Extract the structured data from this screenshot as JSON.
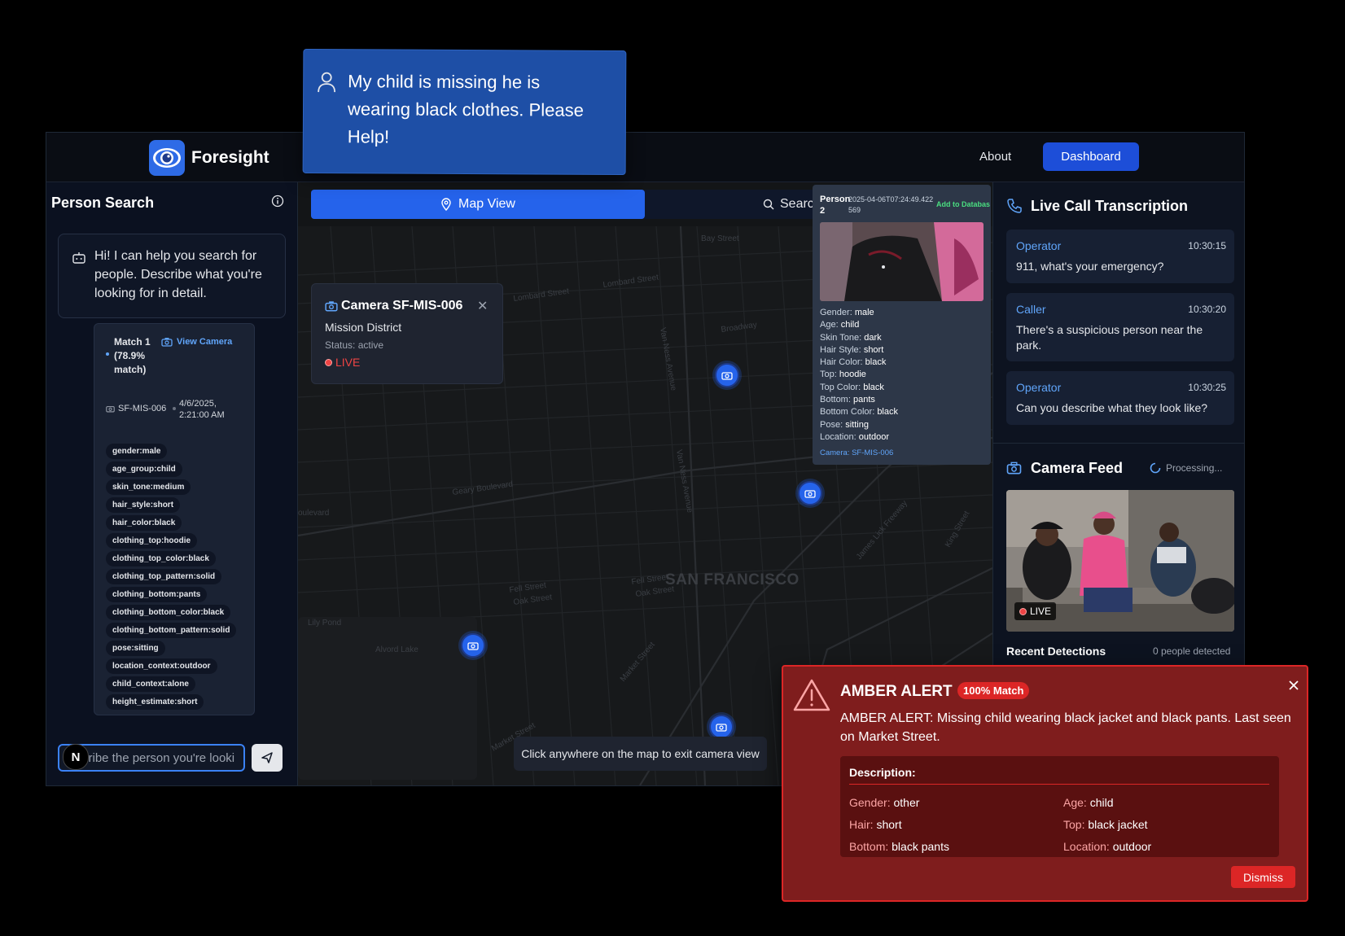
{
  "app": {
    "name": "Foresight",
    "nav": {
      "about": "About",
      "dashboard": "Dashboard"
    }
  },
  "chat_bubble": {
    "text": "My child is missing he is wearing black clothes. Please Help!",
    "icon": "user-icon"
  },
  "person_search": {
    "title": "Person Search",
    "bot_message": "Hi! I can help you search for people. Describe what you're looking for in detail.",
    "match": {
      "title": "Match 1 (78.9% match)",
      "view_camera": "View Camera",
      "camera_id": "SF-MIS-006",
      "timestamp": "4/6/2025, 2:21:00 AM",
      "tags": [
        "gender:male",
        "age_group:child",
        "skin_tone:medium",
        "hair_style:short",
        "hair_color:black",
        "clothing_top:hoodie",
        "clothing_top_color:black",
        "clothing_top_pattern:solid",
        "clothing_bottom:pants",
        "clothing_bottom_color:black",
        "clothing_bottom_pattern:solid",
        "pose:sitting",
        "location_context:outdoor",
        "child_context:alone",
        "height_estimate:short"
      ]
    },
    "input_value": "cribe the person you're looki",
    "avatar_letter": "N"
  },
  "map": {
    "tabs": {
      "map_view": "Map View",
      "search": "Search"
    },
    "city_label": "SAN FRANCISCO",
    "camera_popup": {
      "title": "Camera SF-MIS-006",
      "district": "Mission District",
      "status": "Status: active",
      "live": "LIVE"
    },
    "exit_hint": "Click anywhere on the map to exit camera view",
    "streets": [
      "Bay Street",
      "Lombard Street",
      "Lombard Street",
      "Broadway",
      "Van Ness Avenue",
      "Geary Boulevard",
      "oulevard",
      "Van Ness Avenue",
      "Fell Street",
      "Oak Street",
      "Fell Street",
      "Oak Street",
      "Lily Pond",
      "Alvord Lake",
      "Market Street",
      "Market Street",
      "James Lick Freeway",
      "King Street"
    ]
  },
  "person_popup": {
    "title": "Person 2",
    "timestamp": "2025-04-06T07:24:49.422569",
    "add_to_db": "Add to Databas",
    "attributes": [
      {
        "k": "Gender:",
        "v": "male"
      },
      {
        "k": "Age:",
        "v": "child"
      },
      {
        "k": "Skin Tone:",
        "v": "dark"
      },
      {
        "k": "Hair Style:",
        "v": "short"
      },
      {
        "k": "Hair Color:",
        "v": "black"
      },
      {
        "k": "Top:",
        "v": "hoodie"
      },
      {
        "k": "Top Color:",
        "v": "black"
      },
      {
        "k": "Bottom:",
        "v": "pants"
      },
      {
        "k": "Bottom Color:",
        "v": "black"
      },
      {
        "k": "Pose:",
        "v": "sitting"
      },
      {
        "k": "Location:",
        "v": "outdoor"
      }
    ],
    "camera": "Camera: SF-MIS-006"
  },
  "transcription": {
    "title": "Live Call Transcription",
    "messages": [
      {
        "role": "Operator",
        "time": "10:30:15",
        "text": "911, what's your emergency?"
      },
      {
        "role": "Caller",
        "time": "10:30:20",
        "text": "There's a suspicious person near the park."
      },
      {
        "role": "Operator",
        "time": "10:30:25",
        "text": "Can you describe what they look like?"
      }
    ]
  },
  "camera_feed": {
    "title": "Camera Feed",
    "processing": "Processing...",
    "live": "LIVE",
    "recent_detections": "Recent Detections",
    "people_count": "0 people detected"
  },
  "amber_alert": {
    "title": "AMBER ALERT",
    "badge": "100% Match",
    "message": "AMBER ALERT: Missing child wearing black jacket and black pants. Last seen on Market Street.",
    "description_title": "Description:",
    "fields": {
      "gender": {
        "k": "Gender:",
        "v": "other"
      },
      "age": {
        "k": "Age:",
        "v": "child"
      },
      "hair": {
        "k": "Hair:",
        "v": "short"
      },
      "top": {
        "k": "Top:",
        "v": "black jacket"
      },
      "bottom": {
        "k": "Bottom:",
        "v": "black pants"
      },
      "location": {
        "k": "Location:",
        "v": "outdoor"
      }
    },
    "dismiss": "Dismiss"
  },
  "colors": {
    "accent": "#2563eb",
    "alert_bg": "#7f1d1d",
    "alert_border": "#dc2626",
    "live_red": "#ef4444",
    "link_blue": "#60a5fa",
    "add_green": "#4ade80"
  }
}
